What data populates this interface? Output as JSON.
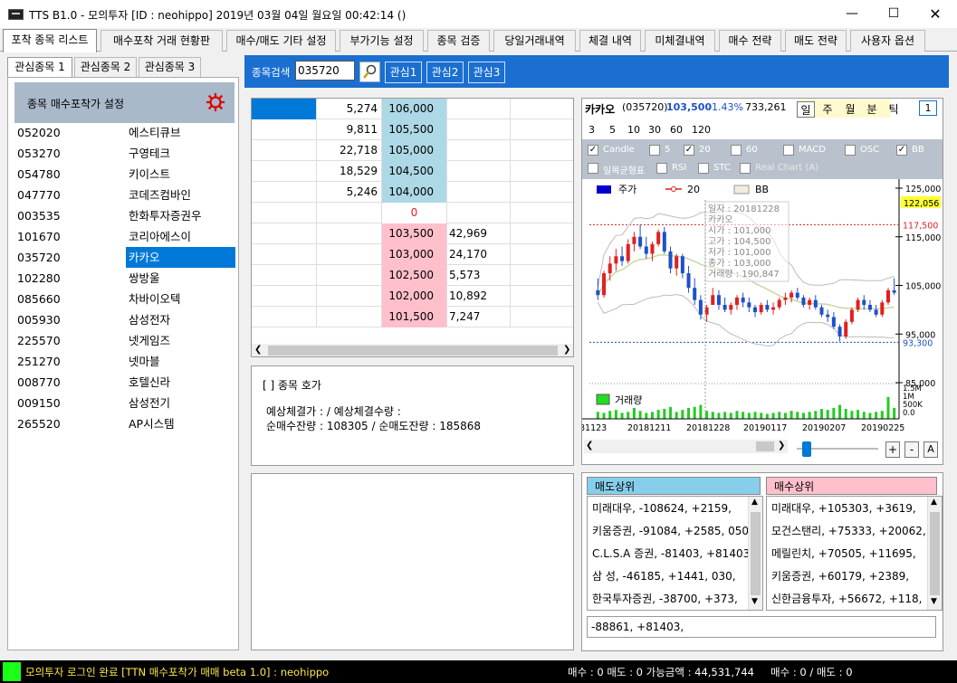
{
  "window": {
    "title": "TTS B1.0 - 모의투자 [ID : neohippo] 2019년 03월 04일 월요일 00:42:14 ()"
  },
  "main_tabs": [
    "포착 종목 리스트",
    "매수포착 거래 현황판",
    "매수/매도 기타 설정",
    "부가기능 설정",
    "종목 검증",
    "당일거래내역",
    "체결 내역",
    "미체결내역",
    "매수 전략",
    "매도 전략",
    "사용자 옵션"
  ],
  "left_tabs": [
    "관심종목 1",
    "관심종목 2",
    "관심종목 3"
  ],
  "setting_label": "종목 매수포착가 설정",
  "stocks": [
    {
      "code": "052020",
      "name": "에스티큐브"
    },
    {
      "code": "053270",
      "name": "구영테크"
    },
    {
      "code": "054780",
      "name": "키이스트"
    },
    {
      "code": "047770",
      "name": "코데즈컴바인"
    },
    {
      "code": "003535",
      "name": "한화투자증권우"
    },
    {
      "code": "101670",
      "name": "코리아에스이"
    },
    {
      "code": "035720",
      "name": "카카오"
    },
    {
      "code": "102280",
      "name": "쌍방울"
    },
    {
      "code": "085660",
      "name": "차바이오텍"
    },
    {
      "code": "005930",
      "name": "삼성전자"
    },
    {
      "code": "225570",
      "name": "넷게임즈"
    },
    {
      "code": "251270",
      "name": "넷마블"
    },
    {
      "code": "008770",
      "name": "호텔신라"
    },
    {
      "code": "009150",
      "name": "삼성전기"
    },
    {
      "code": "265520",
      "name": "AP시스템"
    }
  ],
  "search": {
    "label": "종목검색",
    "value": "035720",
    "fav_buttons": [
      "관심1",
      "관심2",
      "관심3"
    ]
  },
  "quote_rows": [
    {
      "ask_vol": "5,274",
      "price": "106,000",
      "bid_vol": ""
    },
    {
      "ask_vol": "9,811",
      "price": "105,500",
      "bid_vol": ""
    },
    {
      "ask_vol": "22,718",
      "price": "105,000",
      "bid_vol": ""
    },
    {
      "ask_vol": "18,529",
      "price": "104,500",
      "bid_vol": ""
    },
    {
      "ask_vol": "5,246",
      "price": "104,000",
      "bid_vol": ""
    },
    {
      "ask_vol": "",
      "price": "0",
      "bid_vol": ""
    },
    {
      "ask_vol": "",
      "price": "103,500",
      "bid_vol": "42,969"
    },
    {
      "ask_vol": "",
      "price": "103,000",
      "bid_vol": "24,170"
    },
    {
      "ask_vol": "",
      "price": "102,500",
      "bid_vol": "5,573"
    },
    {
      "ask_vol": "",
      "price": "102,000",
      "bid_vol": "10,892"
    },
    {
      "ask_vol": "",
      "price": "101,500",
      "bid_vol": "7,247"
    }
  ],
  "info": {
    "title": "[ ] 종목 호가",
    "line1": "예상체결가 :   / 예상체결수량 :",
    "line2": "순매수잔량 : 108305  / 순매도잔량 : 185868"
  },
  "chart_header": {
    "name": "카카오",
    "code": "(035720)",
    "price": "103,500",
    "change": "-1.43%",
    "volume": "733,261",
    "period_tabs": [
      "일",
      "주",
      "월",
      "분",
      "틱"
    ],
    "period_num": "1",
    "minute_options": [
      "3",
      "5",
      "10",
      "30",
      "60",
      "120"
    ],
    "options_row1": [
      {
        "label": "Candle",
        "checked": true
      },
      {
        "label": "5",
        "checked": false
      },
      {
        "label": "20",
        "checked": true
      },
      {
        "label": "60",
        "checked": false
      },
      {
        "label": "MACD",
        "checked": false
      },
      {
        "label": "OSC",
        "checked": false
      },
      {
        "label": "BB",
        "checked": true
      }
    ],
    "options_row2": [
      {
        "label": "일목균형표",
        "checked": false
      },
      {
        "label": "RSI",
        "checked": false
      },
      {
        "label": "STC",
        "checked": false
      },
      {
        "label": "Real Chart (A)",
        "checked": false
      }
    ]
  },
  "chart_data": {
    "type": "candlestick",
    "legend": [
      "주가",
      "20",
      "BB"
    ],
    "y_ticks": [
      "125,000",
      "115,000",
      "105,000",
      "95,000",
      "85,000"
    ],
    "y_markers": {
      "current": "122,056",
      "high": "117,500",
      "low": "93,300"
    },
    "y_range": [
      85000,
      125000
    ],
    "vol_label": "거래량",
    "vol_ticks": [
      "1.5M",
      "1M",
      "500K",
      "0.0"
    ],
    "x_ticks": [
      "81123",
      "20181211",
      "20181228",
      "20190117",
      "20190207",
      "20190225"
    ],
    "tooltip": [
      "일자  : 20181228",
      "카카오",
      "시가  : 101,000",
      "고가  : 104,500",
      "저가  : 101,000",
      "종가  : 103,000",
      "거래량 : 190,847"
    ],
    "candles": [
      [
        104000,
        106500,
        102000,
        103000
      ],
      [
        103000,
        108000,
        102500,
        107500
      ],
      [
        107500,
        111000,
        106000,
        109500
      ],
      [
        109500,
        112500,
        108000,
        111000
      ],
      [
        111000,
        113000,
        109000,
        110000
      ],
      [
        110000,
        114500,
        109500,
        113500
      ],
      [
        113500,
        116000,
        112000,
        115000
      ],
      [
        115000,
        117500,
        112500,
        113000
      ],
      [
        113000,
        115000,
        110500,
        111500
      ],
      [
        111500,
        114000,
        110000,
        113500
      ],
      [
        113500,
        116500,
        113000,
        116000
      ],
      [
        116000,
        117000,
        111500,
        112000
      ],
      [
        112000,
        113000,
        107500,
        108500
      ],
      [
        108500,
        111500,
        107000,
        111000
      ],
      [
        111000,
        111500,
        106500,
        107500
      ],
      [
        107500,
        109000,
        103500,
        104500
      ],
      [
        104500,
        106500,
        101000,
        102000
      ],
      [
        102000,
        103000,
        98000,
        99000
      ],
      [
        99000,
        101000,
        97500,
        100500
      ],
      [
        101000,
        104500,
        101000,
        103000
      ],
      [
        103000,
        104000,
        100000,
        101000
      ],
      [
        101000,
        102500,
        99500,
        100000
      ],
      [
        100000,
        101500,
        99000,
        101000
      ],
      [
        101000,
        103000,
        100000,
        102500
      ],
      [
        102500,
        103500,
        100500,
        101500
      ],
      [
        101500,
        102500,
        99500,
        100500
      ],
      [
        100500,
        101000,
        98500,
        99500
      ],
      [
        99500,
        101500,
        99000,
        101000
      ],
      [
        101000,
        102000,
        99500,
        100000
      ],
      [
        100000,
        101500,
        99000,
        100500
      ],
      [
        100500,
        102500,
        100000,
        102000
      ],
      [
        102000,
        103500,
        101000,
        102500
      ],
      [
        102500,
        104000,
        101500,
        103500
      ],
      [
        103500,
        104500,
        102000,
        102500
      ],
      [
        102500,
        103000,
        100500,
        101000
      ],
      [
        101000,
        102500,
        100000,
        102000
      ],
      [
        102000,
        103000,
        100000,
        100500
      ],
      [
        100500,
        101000,
        98500,
        99000
      ],
      [
        99000,
        100000,
        97500,
        98500
      ],
      [
        98500,
        99500,
        96000,
        96500
      ],
      [
        96500,
        97000,
        93500,
        94500
      ],
      [
        94500,
        98000,
        94000,
        97500
      ],
      [
        97500,
        100500,
        97000,
        100000
      ],
      [
        100000,
        102500,
        99500,
        102000
      ],
      [
        102000,
        103000,
        100000,
        101000
      ],
      [
        101000,
        102000,
        99500,
        100000
      ],
      [
        100000,
        101000,
        98500,
        99000
      ],
      [
        99000,
        102000,
        98500,
        101500
      ],
      [
        101500,
        104500,
        101000,
        104000
      ],
      [
        104000,
        106500,
        103000,
        103500
      ]
    ],
    "volumes": [
      0.35,
      0.3,
      0.4,
      0.45,
      0.3,
      0.35,
      0.55,
      0.4,
      0.3,
      0.35,
      0.45,
      0.5,
      0.6,
      0.35,
      0.45,
      0.55,
      0.6,
      0.7,
      0.4,
      0.35,
      0.3,
      0.35,
      0.3,
      0.4,
      0.35,
      0.3,
      0.35,
      0.3,
      0.25,
      0.3,
      0.35,
      0.3,
      0.4,
      0.35,
      0.3,
      0.35,
      0.4,
      0.5,
      0.45,
      0.55,
      0.7,
      0.5,
      0.4,
      0.45,
      0.35,
      0.3,
      0.35,
      0.4,
      1.1,
      0.55
    ]
  },
  "chart_controls": {
    "plus": "+",
    "minus": "-",
    "auto": "A"
  },
  "brokers": {
    "sell_title": "매도상위",
    "buy_title": "매수상위",
    "sell": [
      "미래대우, -108624, +2159,",
      "키움증권, -91084, +2585, 050,",
      "C.L.S.A 증권, -81403, +81403,",
      "삼  성, -46185, +1441, 030,",
      "한국투자증권, -38700, +373,"
    ],
    "buy": [
      "미래대우, +105303, +3619,",
      "모건스탠리, +75333, +20062,",
      "메릴린치, +70505, +11695,",
      "키움증권, +60179, +2389,",
      "신한금융투자, +56672, +118,"
    ],
    "summary": "-88861, +81403,"
  },
  "status": {
    "left": "모의투자 로그인 완료 [TTN 매수포착가 매매 beta 1.0] : neohippo",
    "mid": "매수 : 0 매도 : 0 가능금액 : 44,531,744",
    "right": "매수 : 0 / 매도 : 0"
  },
  "colors": {
    "accent": "#1a6fd0",
    "ask": "#add8e6",
    "bid": "#ffc0cb",
    "selected": "#0078d7",
    "up": "#e02020",
    "down": "#1e50c8"
  }
}
